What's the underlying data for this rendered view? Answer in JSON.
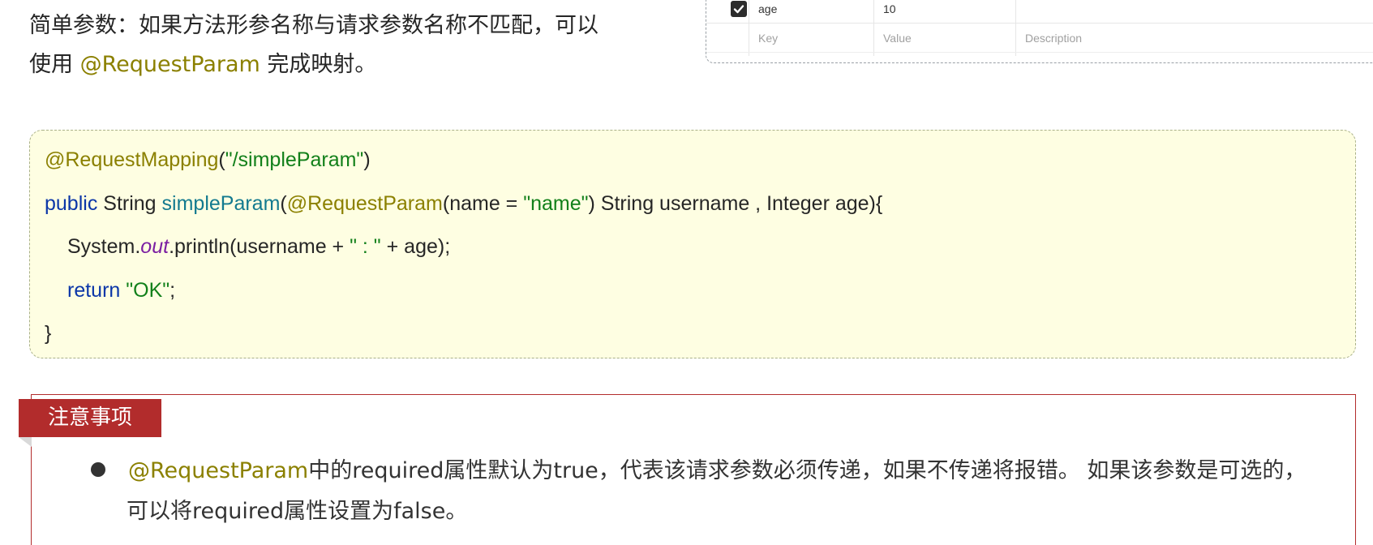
{
  "intro": {
    "prefix": "简单参数：如果方法形参名称与请求参数名称不匹配，可以",
    "line2_before": "使用 ",
    "annotation": "@RequestParam",
    "line2_after": " 完成映射。"
  },
  "param_table": {
    "row1": {
      "checked": true,
      "key": "age",
      "value": "10",
      "description": ""
    },
    "placeholders": {
      "key": "Key",
      "value": "Value",
      "description": "Description"
    }
  },
  "code": {
    "line1": {
      "anno": "@RequestMapping",
      "p1": "(",
      "str": "\"/simpleParam\"",
      "p2": ")"
    },
    "line2": {
      "kw": "public",
      "t1": " String ",
      "fn": "simpleParam",
      "p1": "(",
      "anno": "@RequestParam",
      "p2": "(name = ",
      "str": "\"name\"",
      "p3": ") String username , Integer age){"
    },
    "line3": {
      "t1": "System.",
      "field": "out",
      "t2": ".println(username + ",
      "str": "\" : \"",
      "t3": " + age);"
    },
    "line4": {
      "kw": "return",
      "sp": " ",
      "str": "\"OK\"",
      "t1": ";"
    },
    "line5": {
      "t1": "}"
    }
  },
  "notice": {
    "tag": "注意事项",
    "annotation": "@RequestParam",
    "text1": "中的required属性默认为true，代表该请求参数必须传递，如果不传递将报错。 如果该参数是可选的，",
    "text2": "可以将required属性设置为false。"
  },
  "colors": {
    "olive": "#8b8000",
    "string_green": "#12801a",
    "keyword_blue": "#0b36a8",
    "notice_red": "#b22c2c",
    "code_bg": "#fefee2"
  }
}
